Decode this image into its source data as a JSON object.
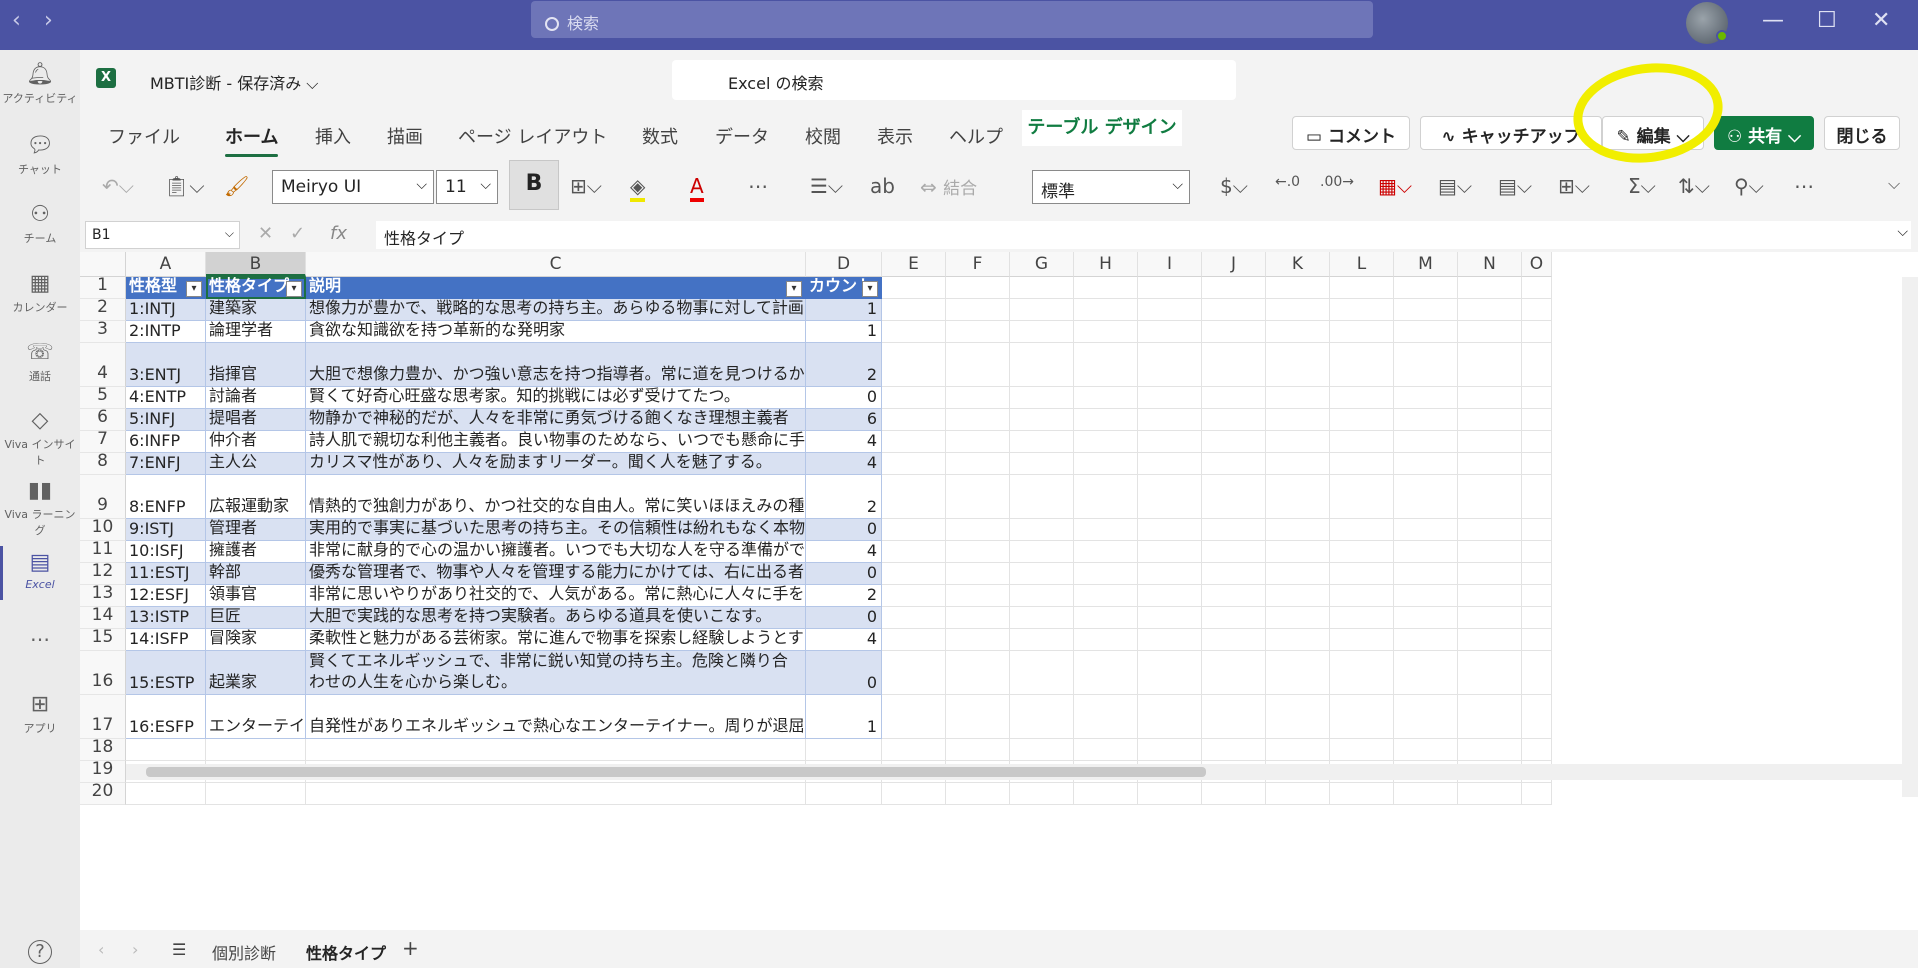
{
  "titlebar": {
    "search_placeholder": "検索",
    "back": "‹",
    "forward": "›",
    "minimize": "—",
    "maximize": "☐",
    "close": "✕"
  },
  "rail": {
    "items": [
      {
        "label": "アクティビティ",
        "icon": "bell-icon"
      },
      {
        "label": "チャット",
        "icon": "chat-icon"
      },
      {
        "label": "チーム",
        "icon": "teams-icon"
      },
      {
        "label": "カレンダー",
        "icon": "calendar-icon"
      },
      {
        "label": "通話",
        "icon": "phone-icon"
      },
      {
        "label": "Viva インサイト",
        "icon": "insights-icon"
      },
      {
        "label": "Viva ラーニング",
        "icon": "learning-icon"
      },
      {
        "label": "Excel",
        "icon": "excel-icon"
      },
      {
        "label": "…",
        "icon": "more-icon"
      },
      {
        "label": "アプリ",
        "icon": "apps-icon"
      },
      {
        "label": "?",
        "icon": "help-icon"
      }
    ]
  },
  "file": {
    "title": "MBTI診断 - 保存済み ⌵",
    "logo": "X",
    "search": "Excel の検索"
  },
  "tabs": [
    "ファイル",
    "ホーム",
    "挿入",
    "描画",
    "ページ レイアウト",
    "数式",
    "データ",
    "校閲",
    "表示",
    "ヘルプ",
    "テーブル デザイン"
  ],
  "actions": {
    "comment": "コメント",
    "catchup": "キャッチアップ",
    "edit": "編集",
    "share": "共有",
    "close": "閉じる"
  },
  "ribbon": {
    "font": "Meiryo UI",
    "size": "11",
    "bold": "B",
    "merge": "結合",
    "number_format": "標準",
    "currency": "$"
  },
  "formula": {
    "namebox": "B1",
    "fx": "fx",
    "value": "性格タイプ"
  },
  "columns": [
    "A",
    "B",
    "C",
    "D",
    "E",
    "F",
    "G",
    "H",
    "I",
    "J",
    "K",
    "L",
    "M",
    "N",
    "O"
  ],
  "headers": [
    "性格型",
    "性格タイプ",
    "説明",
    "カウント"
  ],
  "rows": [
    {
      "n": "2",
      "a": "1:INTJ",
      "b": "建築家",
      "c": "想像力が豊かで、戦略的な思考の持ち主。あらゆる物事に対して計画を立てる。",
      "d": "1"
    },
    {
      "n": "3",
      "a": "2:INTP",
      "b": "論理学者",
      "c": "貪欲な知識欲を持つ革新的な発明家",
      "d": "1"
    },
    {
      "n": "4",
      "a": "3:ENTJ",
      "b": "指揮官",
      "c": "大胆で想像力豊か、かつ強い意志を持つ指導者。常に道を見つけるか、道を切り開く。",
      "d": "2"
    },
    {
      "n": "5",
      "a": "4:ENTP",
      "b": "討論者",
      "c": "賢くて好奇心旺盛な思考家。知的挑戦には必ず受けてたつ。",
      "d": "0"
    },
    {
      "n": "6",
      "a": "5:INFJ",
      "b": "提唱者",
      "c": "物静かで神秘的だが、人々を非常に勇気づける飽くなき理想主義者",
      "d": "6"
    },
    {
      "n": "7",
      "a": "6:INFP",
      "b": "仲介者",
      "c": "詩人肌で親切な利他主義者。良い物事のためなら、いつでも懸命に手を差し伸べる。",
      "d": "4"
    },
    {
      "n": "8",
      "a": "7:ENFJ",
      "b": "主人公",
      "c": "カリスマ性があり、人々を励ますリーダー。聞く人を魅了する。",
      "d": "4"
    },
    {
      "n": "9",
      "a": "8:ENFP",
      "b": "広報運動家",
      "c": "情熱的で独創力があり、かつ社交的な自由人。常に笑いほほえみの種を見つけられる。",
      "d": "2"
    },
    {
      "n": "10",
      "a": "9:ISTJ",
      "b": "管理者",
      "c": "実用的で事実に基づいた思考の持ち主。その信頼性は紛れもなく本物。",
      "d": "0"
    },
    {
      "n": "11",
      "a": "10:ISFJ",
      "b": "擁護者",
      "c": "非常に献身的で心の温かい擁護者。いつでも大切な人を守る準備ができている。",
      "d": "4"
    },
    {
      "n": "12",
      "a": "11:ESTJ",
      "b": "幹部",
      "c": "優秀な管理者で、物事や人々を管理する能力にかけては、右に出る者はいない。",
      "d": "0"
    },
    {
      "n": "13",
      "a": "12:ESFJ",
      "b": "領事官",
      "c": "非常に思いやりがあり社交的で、人気がある。常に熱心に人々に手を差し伸べている。",
      "d": "2"
    },
    {
      "n": "14",
      "a": "13:ISTP",
      "b": "巨匠",
      "c": "大胆で実践的な思考を持つ実験者。あらゆる道具を使いこなす。",
      "d": "0"
    },
    {
      "n": "15",
      "a": "14:ISFP",
      "b": "冒険家",
      "c": "柔軟性と魅力がある芸術家。常に進んで物事を探索し経験しようとする。",
      "d": "4"
    },
    {
      "n": "16",
      "a": "15:ESTP",
      "b": "起業家",
      "c": "賢くてエネルギッシュで、非常に鋭い知覚の持ち主。危険と隣り合わせの人生を心から楽しむ。",
      "d": "0"
    },
    {
      "n": "17",
      "a": "16:ESFP",
      "b": "エンターテイナー",
      "c": "自発性がありエネルギッシュで熱心なエンターテイナー。周りが退屈することは決してない。",
      "d": "1"
    }
  ],
  "empty_rows": [
    "18",
    "19",
    "20"
  ],
  "sheets": {
    "tab1": "個別診断",
    "tab2": "性格タイプ",
    "add": "+"
  }
}
